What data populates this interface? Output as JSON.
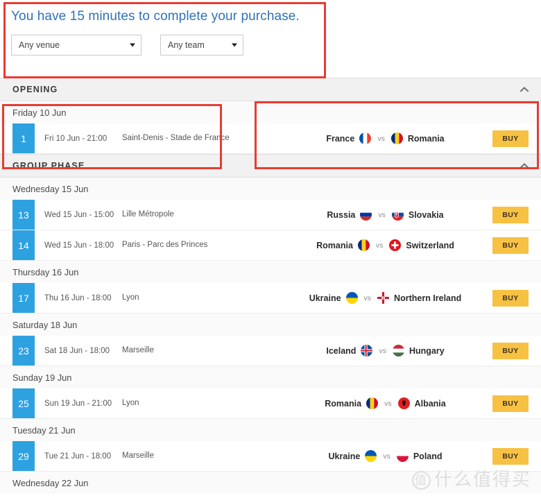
{
  "notice": {
    "text": "You have 15 minutes to complete your purchase.",
    "color": "#3072b5"
  },
  "filters": {
    "venue": {
      "name": "venue-select",
      "value": "Any venue",
      "caret": "caret-down-icon"
    },
    "team": {
      "name": "team-select",
      "value": "Any team",
      "caret": "caret-down-icon"
    }
  },
  "colors": {
    "accent_blue": "#2ea1e0",
    "buy_yellow": "#f7c143",
    "annotation_red": "#e83b32",
    "section_bg": "#f1f1f1"
  },
  "sections": [
    {
      "title": "OPENING",
      "collapse_icon": "chevron-up-icon",
      "days": [
        {
          "label": "Friday 10 Jun",
          "matches": [
            {
              "number": "1",
              "time": "Fri 10 Jun - 21:00",
              "venue": "Saint-Denis - Stade de France",
              "home": "France",
              "home_flag": "flag-france",
              "vs": "vs",
              "away": "Romania",
              "away_flag": "flag-romania",
              "buy": "BUY"
            }
          ]
        }
      ]
    },
    {
      "title": "GROUP PHASE",
      "collapse_icon": "chevron-up-icon",
      "days": [
        {
          "label": "Wednesday 15 Jun",
          "matches": [
            {
              "number": "13",
              "time": "Wed 15 Jun - 15:00",
              "venue": "Lille Métropole",
              "home": "Russia",
              "home_flag": "flag-russia",
              "vs": "vs",
              "away": "Slovakia",
              "away_flag": "flag-slovakia",
              "buy": "BUY"
            },
            {
              "number": "14",
              "time": "Wed 15 Jun - 18:00",
              "venue": "Paris - Parc des Princes",
              "home": "Romania",
              "home_flag": "flag-romania",
              "vs": "vs",
              "away": "Switzerland",
              "away_flag": "flag-switzerland",
              "buy": "BUY"
            }
          ]
        },
        {
          "label": "Thursday 16 Jun",
          "matches": [
            {
              "number": "17",
              "time": "Thu 16 Jun - 18:00",
              "venue": "Lyon",
              "home": "Ukraine",
              "home_flag": "flag-ukraine",
              "vs": "vs",
              "away": "Northern Ireland",
              "away_flag": "flag-northern-ireland",
              "buy": "BUY"
            }
          ]
        },
        {
          "label": "Saturday 18 Jun",
          "matches": [
            {
              "number": "23",
              "time": "Sat 18 Jun - 18:00",
              "venue": "Marseille",
              "home": "Iceland",
              "home_flag": "flag-iceland",
              "vs": "vs",
              "away": "Hungary",
              "away_flag": "flag-hungary",
              "buy": "BUY"
            }
          ]
        },
        {
          "label": "Sunday 19 Jun",
          "matches": [
            {
              "number": "25",
              "time": "Sun 19 Jun - 21:00",
              "venue": "Lyon",
              "home": "Romania",
              "home_flag": "flag-romania",
              "vs": "vs",
              "away": "Albania",
              "away_flag": "flag-albania",
              "buy": "BUY"
            }
          ]
        },
        {
          "label": "Tuesday 21 Jun",
          "matches": [
            {
              "number": "29",
              "time": "Tue 21 Jun - 18:00",
              "venue": "Marseille",
              "home": "Ukraine",
              "home_flag": "flag-ukraine",
              "vs": "vs",
              "away": "Poland",
              "away_flag": "flag-poland",
              "buy": "BUY"
            }
          ]
        },
        {
          "label": "Wednesday 22 Jun",
          "matches": []
        }
      ]
    }
  ],
  "watermark": {
    "ring": "值",
    "text": "什么值得买"
  }
}
